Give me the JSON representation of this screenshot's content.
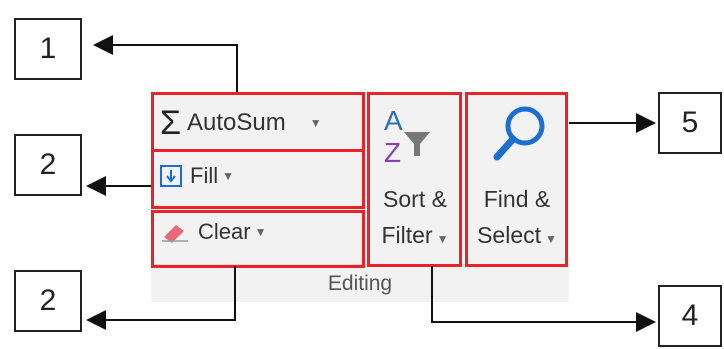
{
  "ribbon": {
    "group_label": "Editing",
    "autosum": {
      "label": "AutoSum",
      "icon": "sigma-icon"
    },
    "fill": {
      "label": "Fill",
      "icon": "fill-down-icon"
    },
    "clear": {
      "label": "Clear",
      "icon": "eraser-icon"
    },
    "sort_filter": {
      "label_line1": "Sort &",
      "label_line2": "Filter",
      "icon": "sort-filter-icon"
    },
    "find_select": {
      "label_line1": "Find &",
      "label_line2": "Select",
      "icon": "magnifier-icon"
    }
  },
  "callouts": [
    "1",
    "2",
    "2",
    "4",
    "5"
  ],
  "colors": {
    "highlight": "#e8232a",
    "ribbon_bg": "#f2f2f2",
    "fill_icon": "#1a6fd1",
    "eraser": "#e86a7a",
    "az_blue": "#2f6fb8",
    "az_purple": "#8a3fae"
  }
}
